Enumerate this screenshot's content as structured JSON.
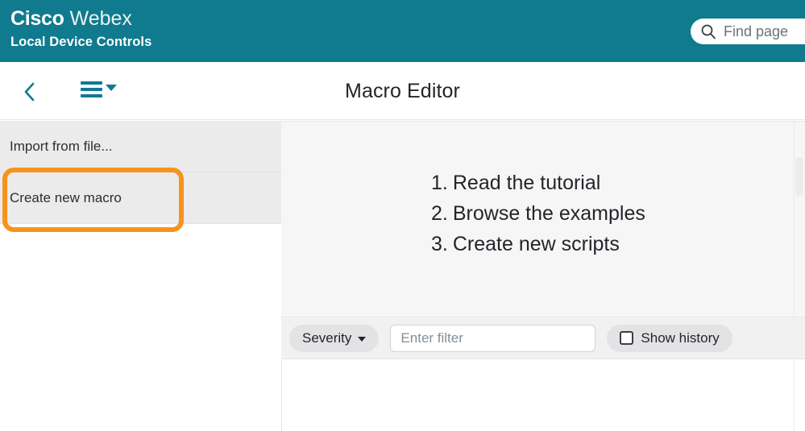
{
  "header": {
    "brand_bold": "Cisco",
    "brand_light": "Webex",
    "subtitle": "Local Device Controls",
    "teal": "#107a8e",
    "search": {
      "icon": "search-icon",
      "placeholder": "Find page",
      "value": ""
    }
  },
  "navbar": {
    "back_icon": "chevron-left-icon",
    "menu_icon": "hamburger-menu-icon",
    "menu_caret_icon": "caret-down-icon",
    "title": "Macro Editor"
  },
  "sidebar": {
    "items": [
      {
        "label": "Import from file...",
        "name": "import-from-file"
      },
      {
        "label": "Create new macro",
        "name": "create-new-macro"
      }
    ]
  },
  "annotation": {
    "color": "#f7931d",
    "target": "create-new-macro"
  },
  "main": {
    "steps": [
      {
        "num": "1.",
        "text": "Read the tutorial"
      },
      {
        "num": "2.",
        "text": "Browse the examples"
      },
      {
        "num": "3.",
        "text": "Create new scripts"
      }
    ]
  },
  "toolbar": {
    "severity_label": "Severity",
    "severity_caret_icon": "caret-down-icon",
    "filter_placeholder": "Enter filter",
    "filter_value": "",
    "show_history_label": "Show history",
    "show_history_checked": false
  }
}
